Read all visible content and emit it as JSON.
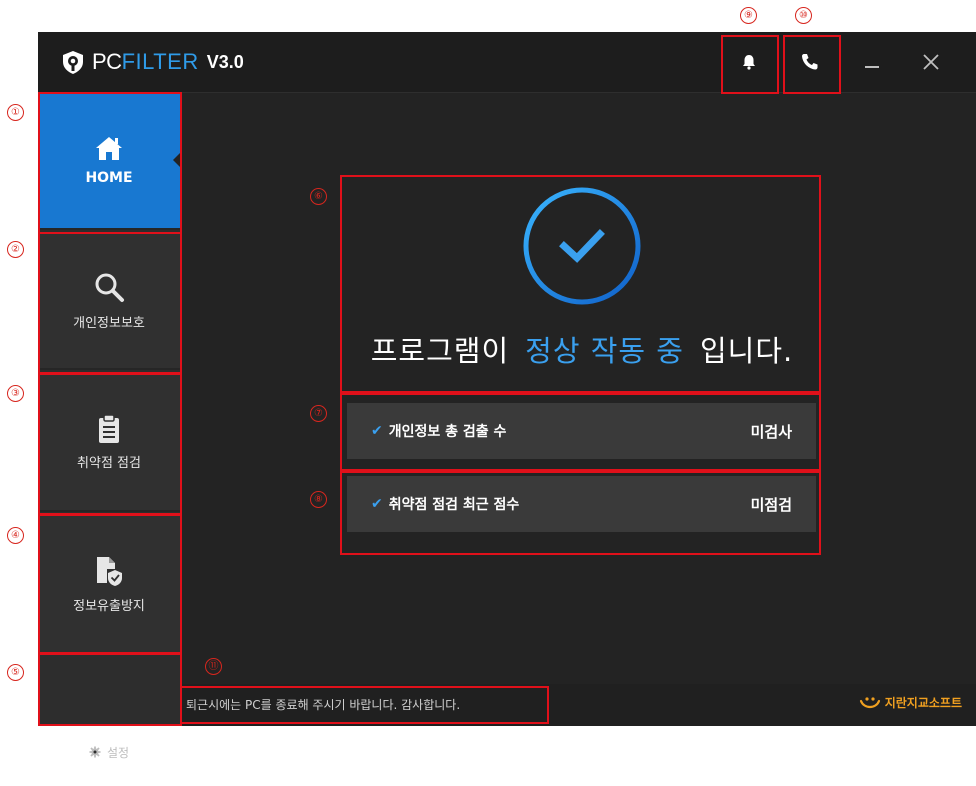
{
  "app": {
    "logo_pc": "PC",
    "logo_filter": "FILTER",
    "version": "V3.0"
  },
  "titlebar": {
    "notification_icon": "bell-icon",
    "phone_icon": "phone-icon",
    "minimize": "_",
    "close": "✕"
  },
  "sidebar": {
    "items": [
      {
        "label": "HOME",
        "icon": "home-icon",
        "active": true
      },
      {
        "label": "개인정보보호",
        "icon": "search-icon"
      },
      {
        "label": "취약점 점검",
        "icon": "clipboard-icon"
      },
      {
        "label": "정보유출방지",
        "icon": "file-shield-icon"
      }
    ],
    "settings_label": "설정"
  },
  "status": {
    "prefix": "프로그램이",
    "highlight": "정상 작동 중",
    "suffix": "입니다."
  },
  "info_rows": [
    {
      "label": "개인정보 총 검출 수",
      "value": "미검사"
    },
    {
      "label": "취약점 점검 최근 점수",
      "value": "미점검"
    }
  ],
  "footer": {
    "message": "퇴근시에는 PC를 종료해 주시기 바랍니다. 감사합니다.",
    "brand": "지란지교소프트"
  },
  "markers": [
    "①",
    "②",
    "③",
    "④",
    "⑤",
    "⑥",
    "⑦",
    "⑧",
    "⑨",
    "⑩",
    "⑪"
  ],
  "colors": {
    "accent": "#1878d1",
    "highlight": "#3aa0ef",
    "annotation": "#e0101a",
    "brand": "#f0a020"
  }
}
